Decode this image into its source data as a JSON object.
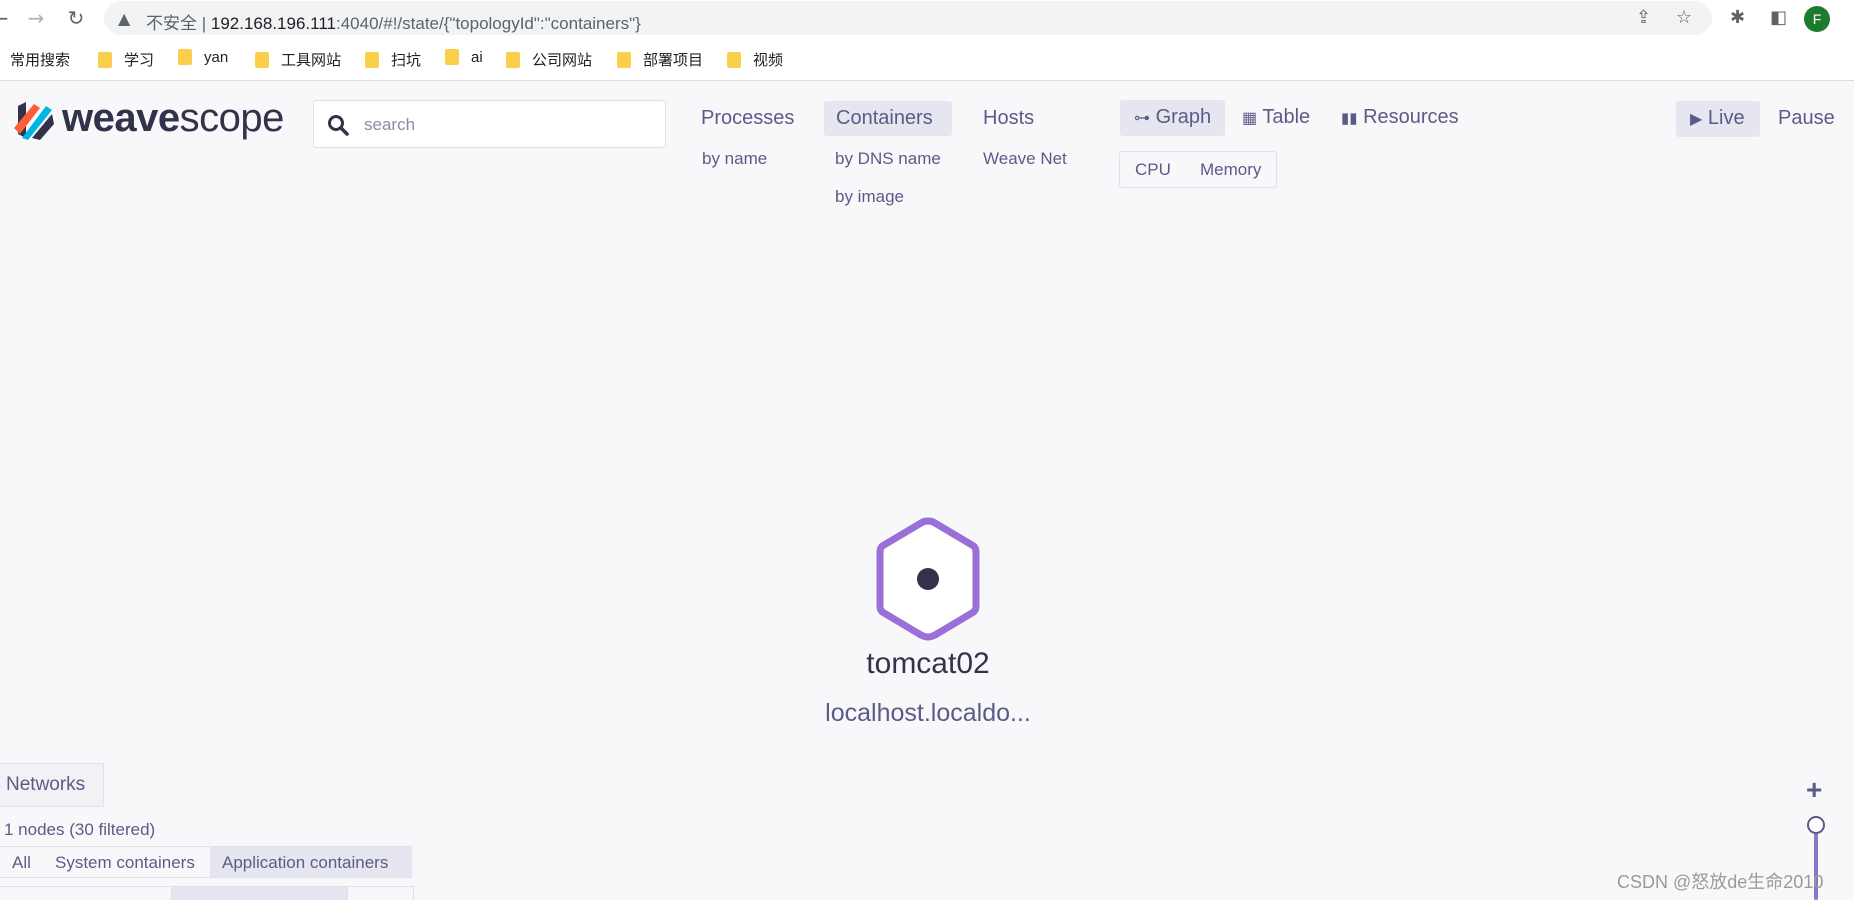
{
  "browser": {
    "security_label": "不安全",
    "url_host": "192.168.196.111",
    "url_rest": ":4040/#!/state/{\"topologyId\":\"containers\"}",
    "profile_initial": "F",
    "bookmarks": [
      {
        "label": "常用搜索"
      },
      {
        "label": "学习"
      },
      {
        "label": "yan"
      },
      {
        "label": "工具网站"
      },
      {
        "label": "扫坑"
      },
      {
        "label": "ai"
      },
      {
        "label": "公司网站"
      },
      {
        "label": "部署项目"
      },
      {
        "label": "视频"
      }
    ]
  },
  "app": {
    "logo_bold": "weave",
    "logo_light": "scope",
    "search_placeholder": "search",
    "topologies": [
      {
        "label": "Processes",
        "subs": [
          "by name"
        ],
        "active": false
      },
      {
        "label": "Containers",
        "subs": [
          "by DNS name",
          "by image"
        ],
        "active": true
      },
      {
        "label": "Hosts",
        "subs": [
          "Weave Net"
        ],
        "active": false
      }
    ],
    "views": [
      {
        "label": "Graph",
        "icon": "sitemap-icon",
        "active": true
      },
      {
        "label": "Table",
        "icon": "table-icon",
        "active": false
      },
      {
        "label": "Resources",
        "icon": "bar-chart-icon",
        "active": false
      }
    ],
    "metrics": [
      "CPU",
      "Memory"
    ],
    "live_label": "Live",
    "pause_label": "Pause",
    "node": {
      "label": "tomcat02",
      "sublabel": "localhost.localdo...",
      "color": "#9b6fd8"
    },
    "networks_label": "Networks",
    "node_count": "1 nodes (30 filtered)",
    "filters": [
      {
        "label": "All",
        "active": false
      },
      {
        "label": "System containers",
        "active": false
      },
      {
        "label": "Application containers",
        "active": true
      }
    ],
    "zoom_in": "+",
    "watermark": "CSDN @怒放de生命2010"
  }
}
